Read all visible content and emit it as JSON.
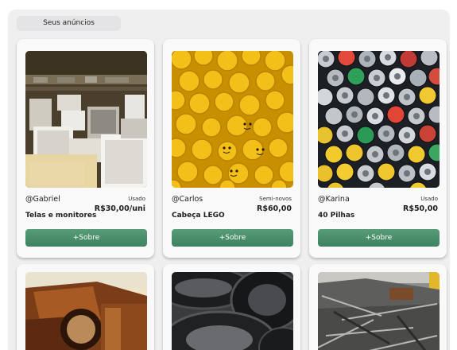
{
  "section": {
    "title": "Seus anúncios"
  },
  "listings": [
    {
      "user": "@Gabriel",
      "condition": "Usado",
      "price": "R$30,00/uni",
      "title": "Telas e monitores",
      "button": "+Sobre",
      "image": "monitors-pile"
    },
    {
      "user": "@Carlos",
      "condition": "Semi-novos",
      "price": "R$60,00",
      "title": "Cabeça LEGO",
      "button": "+Sobre",
      "image": "lego-heads"
    },
    {
      "user": "@Karina",
      "condition": "Usado",
      "price": "R$50,00",
      "title": "40 Pilhas",
      "button": "+Sobre",
      "image": "batteries"
    }
  ],
  "second_row_images": [
    "rusty-metal",
    "old-tires",
    "scrap-metal"
  ],
  "colors": {
    "button": "#4a8f6b",
    "panel": "#efeff0",
    "card": "#f9f9f9"
  }
}
